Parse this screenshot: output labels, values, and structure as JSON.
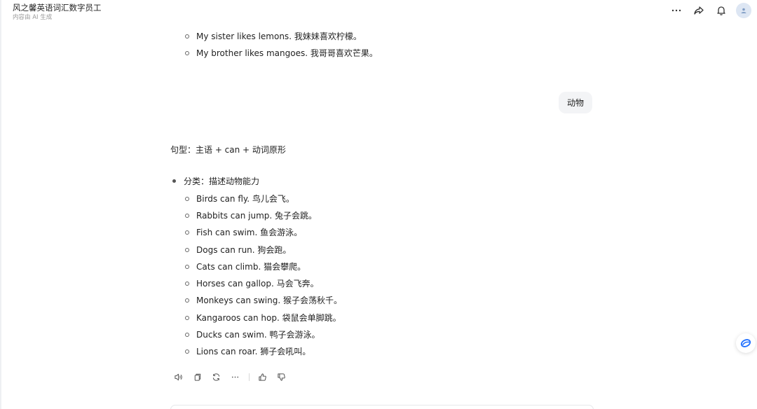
{
  "header": {
    "title": "风之馨英语词汇数字员工",
    "subtitle": "内容由 AI 生成",
    "icons": [
      "more-icon",
      "share-icon",
      "bell-icon",
      "avatar-icon"
    ]
  },
  "fruits_tail": [
    "My sister likes lemons. 我妹妹喜欢柠檬。",
    "My brother likes mangoes. 我哥哥喜欢芒果。"
  ],
  "user_message": "动物",
  "reply": {
    "pattern": "句型：主语 + can + 动词原形",
    "category": "分类：描述动物能力",
    "examples": [
      "Birds can fly. 鸟儿会飞。",
      "Rabbits can jump. 兔子会跳。",
      "Fish can swim. 鱼会游泳。",
      "Dogs can run. 狗会跑。",
      "Cats can climb. 猫会攀爬。",
      "Horses can gallop. 马会飞奔。",
      "Monkeys can swing. 猴子会荡秋千。",
      "Kangaroos can hop. 袋鼠会单脚跳。",
      "Ducks can swim. 鸭子会游泳。",
      "Lions can roar. 狮子会吼叫。"
    ]
  },
  "toolbar_icons": [
    "speaker-icon",
    "copy-icon",
    "regenerate-icon",
    "more-icon",
    "thumbs-up-icon",
    "thumbs-down-icon"
  ],
  "colors": {
    "accent": "#1f6fff",
    "bubble_bg": "#f3f4f6",
    "avatar_bg": "#dde6f3"
  }
}
